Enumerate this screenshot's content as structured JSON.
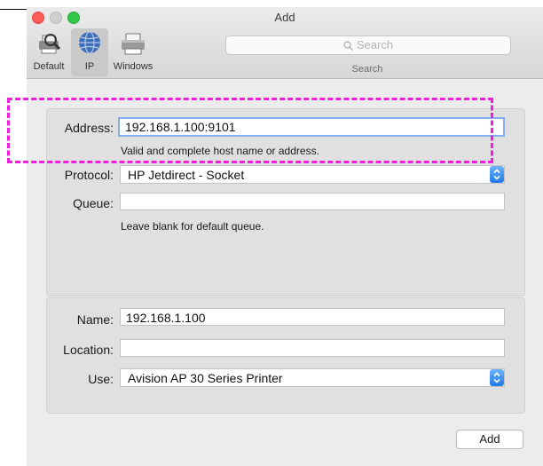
{
  "window": {
    "title": "Add"
  },
  "toolbar": {
    "items": [
      {
        "label": "Default",
        "icon": "default-printers-icon"
      },
      {
        "label": "IP",
        "icon": "globe-icon"
      },
      {
        "label": "Windows",
        "icon": "windows-printer-icon"
      }
    ],
    "selected": "IP",
    "search_placeholder": "Search",
    "search_caption": "Search"
  },
  "form": {
    "address_label": "Address:",
    "address_value": "192.168.1.100:9101",
    "address_hint": "Valid and complete host name or address.",
    "protocol_label": "Protocol:",
    "protocol_value": "HP Jetdirect - Socket",
    "queue_label": "Queue:",
    "queue_value": "",
    "queue_hint": "Leave blank for default queue.",
    "name_label": "Name:",
    "name_value": "192.168.1.100",
    "location_label": "Location:",
    "location_value": "",
    "use_label": "Use:",
    "use_value": "Avision AP 30 Series Printer"
  },
  "actions": {
    "add_label": "Add"
  },
  "colors": {
    "highlight": "#f11ee0",
    "focus_ring": "#82aef0",
    "stepper": "#1e79e6",
    "close": "#fc5d56",
    "maximize": "#34c84a"
  }
}
